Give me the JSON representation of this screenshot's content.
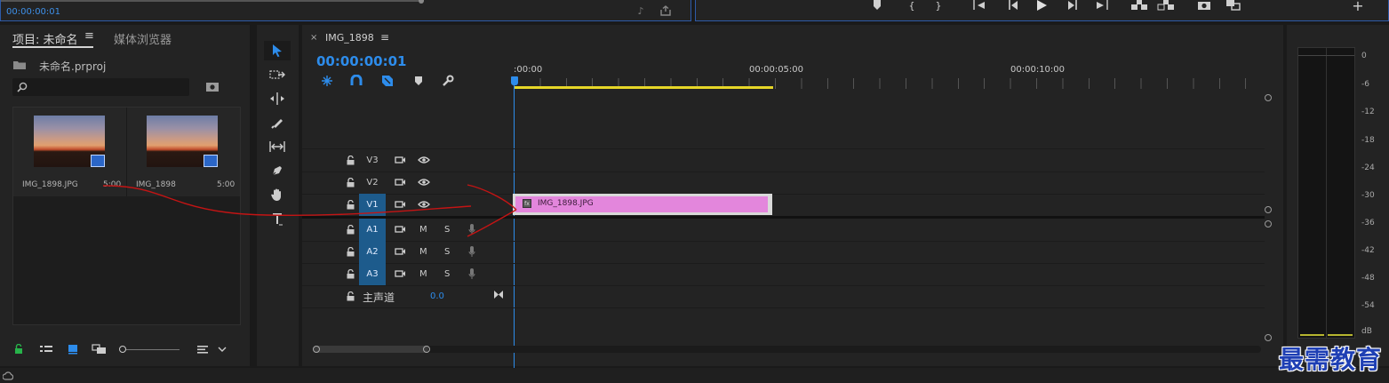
{
  "top_left": {
    "timecode": "00:00:00:01"
  },
  "project": {
    "tabs": [
      {
        "label": "项目: 未命名"
      },
      {
        "label": "媒体浏览器"
      }
    ],
    "menu_glyph": "≡",
    "file_name": "未命名.prproj",
    "search_placeholder": "",
    "items": [
      {
        "name": "IMG_1898.JPG",
        "duration": "5:00"
      },
      {
        "name": "IMG_1898",
        "duration": "5:00"
      }
    ]
  },
  "timeline": {
    "close_glyph": "×",
    "sequence_name": "IMG_1898",
    "menu_glyph": "≡",
    "current_time": "00:00:00:01",
    "ruler": [
      ":00:00",
      "00:00:05:00",
      "00:00:10:00"
    ],
    "video_tracks": [
      {
        "label": "V3"
      },
      {
        "label": "V2"
      },
      {
        "label": "V1"
      }
    ],
    "audio_tracks": [
      {
        "label": "A1",
        "m": "M",
        "s": "S"
      },
      {
        "label": "A2",
        "m": "M",
        "s": "S"
      },
      {
        "label": "A3",
        "m": "M",
        "s": "S"
      }
    ],
    "master": {
      "label": "主声道",
      "value": "0.0"
    },
    "clip": {
      "name": "IMG_1898.JPG",
      "color": "#e386dc"
    }
  },
  "meters": {
    "scale": [
      "0",
      "-6",
      "-12",
      "-18",
      "-24",
      "-30",
      "-36",
      "-42",
      "-48",
      "-54",
      "dB"
    ]
  },
  "watermark": "最需教育",
  "colors": {
    "accent": "#2d8ceb",
    "clip": "#e386dc",
    "track_on": "#1d5b8c",
    "playhead": "#2d8ceb",
    "work_area": "#e6d628",
    "annotation": "#c41414"
  }
}
